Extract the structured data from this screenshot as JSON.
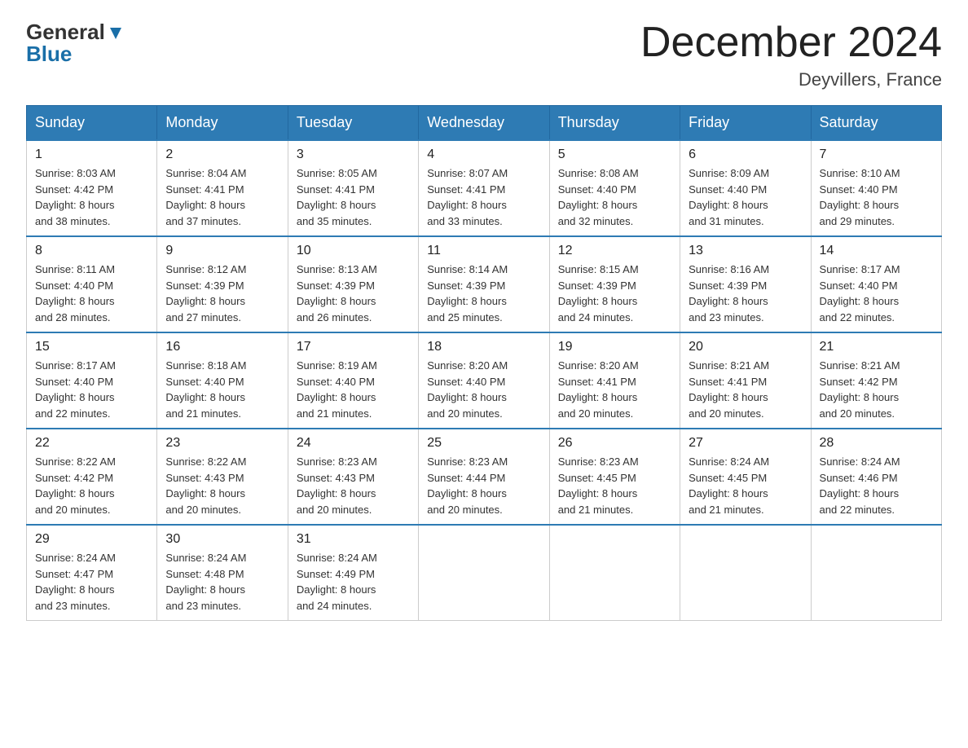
{
  "header": {
    "logo_line1": "General",
    "logo_line2": "Blue",
    "month_title": "December 2024",
    "location": "Deyvillers, France"
  },
  "weekdays": [
    "Sunday",
    "Monday",
    "Tuesday",
    "Wednesday",
    "Thursday",
    "Friday",
    "Saturday"
  ],
  "weeks": [
    [
      {
        "day": "1",
        "sunrise": "8:03 AM",
        "sunset": "4:42 PM",
        "daylight": "8 hours and 38 minutes."
      },
      {
        "day": "2",
        "sunrise": "8:04 AM",
        "sunset": "4:41 PM",
        "daylight": "8 hours and 37 minutes."
      },
      {
        "day": "3",
        "sunrise": "8:05 AM",
        "sunset": "4:41 PM",
        "daylight": "8 hours and 35 minutes."
      },
      {
        "day": "4",
        "sunrise": "8:07 AM",
        "sunset": "4:41 PM",
        "daylight": "8 hours and 33 minutes."
      },
      {
        "day": "5",
        "sunrise": "8:08 AM",
        "sunset": "4:40 PM",
        "daylight": "8 hours and 32 minutes."
      },
      {
        "day": "6",
        "sunrise": "8:09 AM",
        "sunset": "4:40 PM",
        "daylight": "8 hours and 31 minutes."
      },
      {
        "day": "7",
        "sunrise": "8:10 AM",
        "sunset": "4:40 PM",
        "daylight": "8 hours and 29 minutes."
      }
    ],
    [
      {
        "day": "8",
        "sunrise": "8:11 AM",
        "sunset": "4:40 PM",
        "daylight": "8 hours and 28 minutes."
      },
      {
        "day": "9",
        "sunrise": "8:12 AM",
        "sunset": "4:39 PM",
        "daylight": "8 hours and 27 minutes."
      },
      {
        "day": "10",
        "sunrise": "8:13 AM",
        "sunset": "4:39 PM",
        "daylight": "8 hours and 26 minutes."
      },
      {
        "day": "11",
        "sunrise": "8:14 AM",
        "sunset": "4:39 PM",
        "daylight": "8 hours and 25 minutes."
      },
      {
        "day": "12",
        "sunrise": "8:15 AM",
        "sunset": "4:39 PM",
        "daylight": "8 hours and 24 minutes."
      },
      {
        "day": "13",
        "sunrise": "8:16 AM",
        "sunset": "4:39 PM",
        "daylight": "8 hours and 23 minutes."
      },
      {
        "day": "14",
        "sunrise": "8:17 AM",
        "sunset": "4:40 PM",
        "daylight": "8 hours and 22 minutes."
      }
    ],
    [
      {
        "day": "15",
        "sunrise": "8:17 AM",
        "sunset": "4:40 PM",
        "daylight": "8 hours and 22 minutes."
      },
      {
        "day": "16",
        "sunrise": "8:18 AM",
        "sunset": "4:40 PM",
        "daylight": "8 hours and 21 minutes."
      },
      {
        "day": "17",
        "sunrise": "8:19 AM",
        "sunset": "4:40 PM",
        "daylight": "8 hours and 21 minutes."
      },
      {
        "day": "18",
        "sunrise": "8:20 AM",
        "sunset": "4:40 PM",
        "daylight": "8 hours and 20 minutes."
      },
      {
        "day": "19",
        "sunrise": "8:20 AM",
        "sunset": "4:41 PM",
        "daylight": "8 hours and 20 minutes."
      },
      {
        "day": "20",
        "sunrise": "8:21 AM",
        "sunset": "4:41 PM",
        "daylight": "8 hours and 20 minutes."
      },
      {
        "day": "21",
        "sunrise": "8:21 AM",
        "sunset": "4:42 PM",
        "daylight": "8 hours and 20 minutes."
      }
    ],
    [
      {
        "day": "22",
        "sunrise": "8:22 AM",
        "sunset": "4:42 PM",
        "daylight": "8 hours and 20 minutes."
      },
      {
        "day": "23",
        "sunrise": "8:22 AM",
        "sunset": "4:43 PM",
        "daylight": "8 hours and 20 minutes."
      },
      {
        "day": "24",
        "sunrise": "8:23 AM",
        "sunset": "4:43 PM",
        "daylight": "8 hours and 20 minutes."
      },
      {
        "day": "25",
        "sunrise": "8:23 AM",
        "sunset": "4:44 PM",
        "daylight": "8 hours and 20 minutes."
      },
      {
        "day": "26",
        "sunrise": "8:23 AM",
        "sunset": "4:45 PM",
        "daylight": "8 hours and 21 minutes."
      },
      {
        "day": "27",
        "sunrise": "8:24 AM",
        "sunset": "4:45 PM",
        "daylight": "8 hours and 21 minutes."
      },
      {
        "day": "28",
        "sunrise": "8:24 AM",
        "sunset": "4:46 PM",
        "daylight": "8 hours and 22 minutes."
      }
    ],
    [
      {
        "day": "29",
        "sunrise": "8:24 AM",
        "sunset": "4:47 PM",
        "daylight": "8 hours and 23 minutes."
      },
      {
        "day": "30",
        "sunrise": "8:24 AM",
        "sunset": "4:48 PM",
        "daylight": "8 hours and 23 minutes."
      },
      {
        "day": "31",
        "sunrise": "8:24 AM",
        "sunset": "4:49 PM",
        "daylight": "8 hours and 24 minutes."
      },
      null,
      null,
      null,
      null
    ]
  ],
  "labels": {
    "sunrise": "Sunrise:",
    "sunset": "Sunset:",
    "daylight": "Daylight:"
  }
}
